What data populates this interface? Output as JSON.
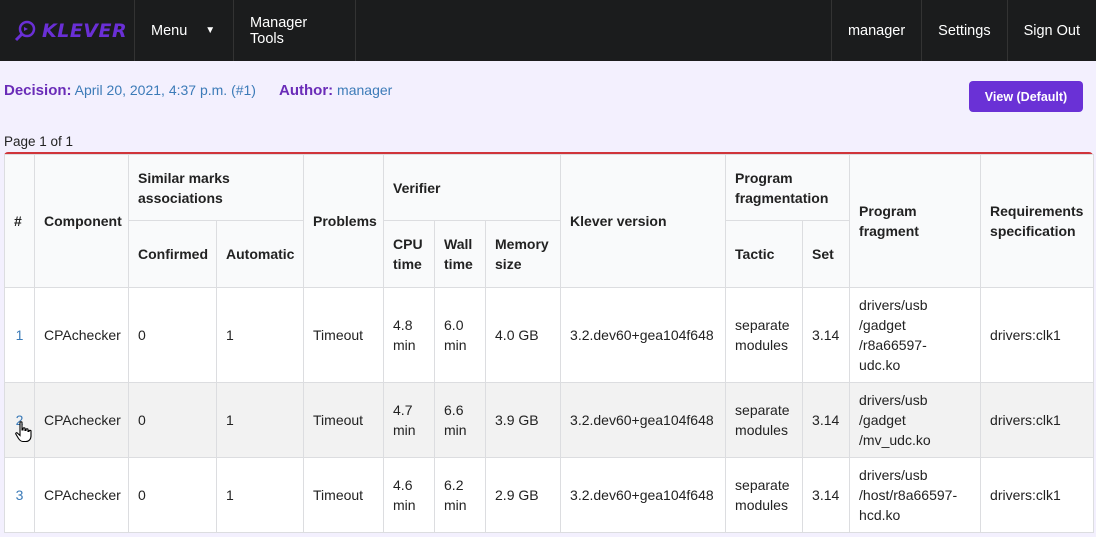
{
  "nav": {
    "logo": "KLEVER",
    "menu_label": "Menu",
    "tools_label": "Manager Tools",
    "user_label": "manager",
    "settings_label": "Settings",
    "signout_label": "Sign Out"
  },
  "decision": {
    "label": "Decision:",
    "value": "April 20, 2021, 4:37 p.m. (#1)",
    "author_label": "Author:",
    "author_value": "manager",
    "view_button": "View (Default)",
    "page_info": "Page 1 of 1"
  },
  "table": {
    "headers": {
      "num": "#",
      "component": "Component",
      "similar": "Similar marks associations",
      "confirmed": "Confirmed",
      "automatic": "Automatic",
      "problems": "Problems",
      "verifier": "Verifier",
      "cpu": "CPU time",
      "wall": "Wall time",
      "memory": "Memory size",
      "klever": "Klever version",
      "fragmentation": "Program fragmentation",
      "tactic": "Tactic",
      "set": "Set",
      "fragment": "Program fragment",
      "req": "Requirements specification"
    },
    "rows": [
      {
        "num": "1",
        "component": "CPAchecker",
        "confirmed": "0",
        "automatic": "1",
        "problems": "Timeout",
        "cpu": "4.8 min",
        "wall": "6.0 min",
        "memory": "4.0 GB",
        "klever": "3.2.dev60+gea104f648",
        "tactic": "separate modules",
        "set": "3.14",
        "fragment": "drivers/usb /gadget /r8a66597- udc.ko",
        "req": "drivers:clk1"
      },
      {
        "num": "2",
        "component": "CPAchecker",
        "confirmed": "0",
        "automatic": "1",
        "problems": "Timeout",
        "cpu": "4.7 min",
        "wall": "6.6 min",
        "memory": "3.9 GB",
        "klever": "3.2.dev60+gea104f648",
        "tactic": "separate modules",
        "set": "3.14",
        "fragment": "drivers/usb /gadget /mv_udc.ko",
        "req": "drivers:clk1"
      },
      {
        "num": "3",
        "component": "CPAchecker",
        "confirmed": "0",
        "automatic": "1",
        "problems": "Timeout",
        "cpu": "4.6 min",
        "wall": "6.2 min",
        "memory": "2.9 GB",
        "klever": "3.2.dev60+gea104f648",
        "tactic": "separate modules",
        "set": "3.14",
        "fragment": "drivers/usb /host/r8a66597- hcd.ko",
        "req": "drivers:clk1"
      }
    ]
  }
}
